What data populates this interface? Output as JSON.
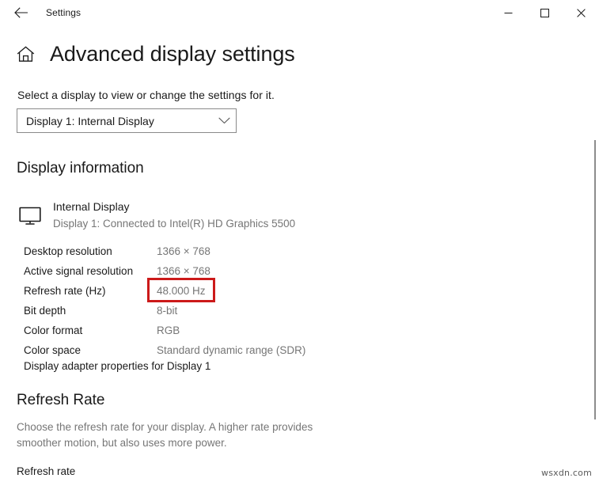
{
  "window": {
    "app_title": "Settings",
    "back_icon": "arrow-left-icon",
    "controls": {
      "minimize_label": "─",
      "maximize_label": "☐",
      "close_label": "✕"
    }
  },
  "header": {
    "home_icon": "home-icon",
    "page_title": "Advanced display settings"
  },
  "display_selector": {
    "instruction": "Select a display to view or change the settings for it.",
    "selected_option": "Display 1: Internal Display",
    "chevron_icon": "chevron-down-icon"
  },
  "display_information": {
    "section_title": "Display information",
    "device": {
      "icon": "monitor-icon",
      "name": "Internal Display",
      "connection": "Display 1: Connected to Intel(R) HD Graphics 5500"
    },
    "rows": [
      {
        "label": "Desktop resolution",
        "value": "1366 × 768",
        "highlighted": false
      },
      {
        "label": "Active signal resolution",
        "value": "1366 × 768",
        "highlighted": false
      },
      {
        "label": "Refresh rate (Hz)",
        "value": "48.000 Hz",
        "highlighted": true
      },
      {
        "label": "Bit depth",
        "value": "8-bit",
        "highlighted": false
      },
      {
        "label": "Color format",
        "value": "RGB",
        "highlighted": false
      },
      {
        "label": "Color space",
        "value": "Standard dynamic range (SDR)",
        "highlighted": false
      }
    ],
    "adapter_link": "Display adapter properties for Display 1"
  },
  "refresh_rate_section": {
    "section_title": "Refresh Rate",
    "description": "Choose the refresh rate for your display. A higher rate provides smoother motion, but also uses more power.",
    "field_label": "Refresh rate"
  },
  "colors": {
    "highlight_box": "#cc1a1a",
    "text_primary": "#1a1a1a",
    "text_secondary": "#767676",
    "background": "#ffffff",
    "combo_border": "#8a8a8a",
    "scrollbar_thumb": "#8c8c8c"
  },
  "watermark": "wsxdn.com"
}
